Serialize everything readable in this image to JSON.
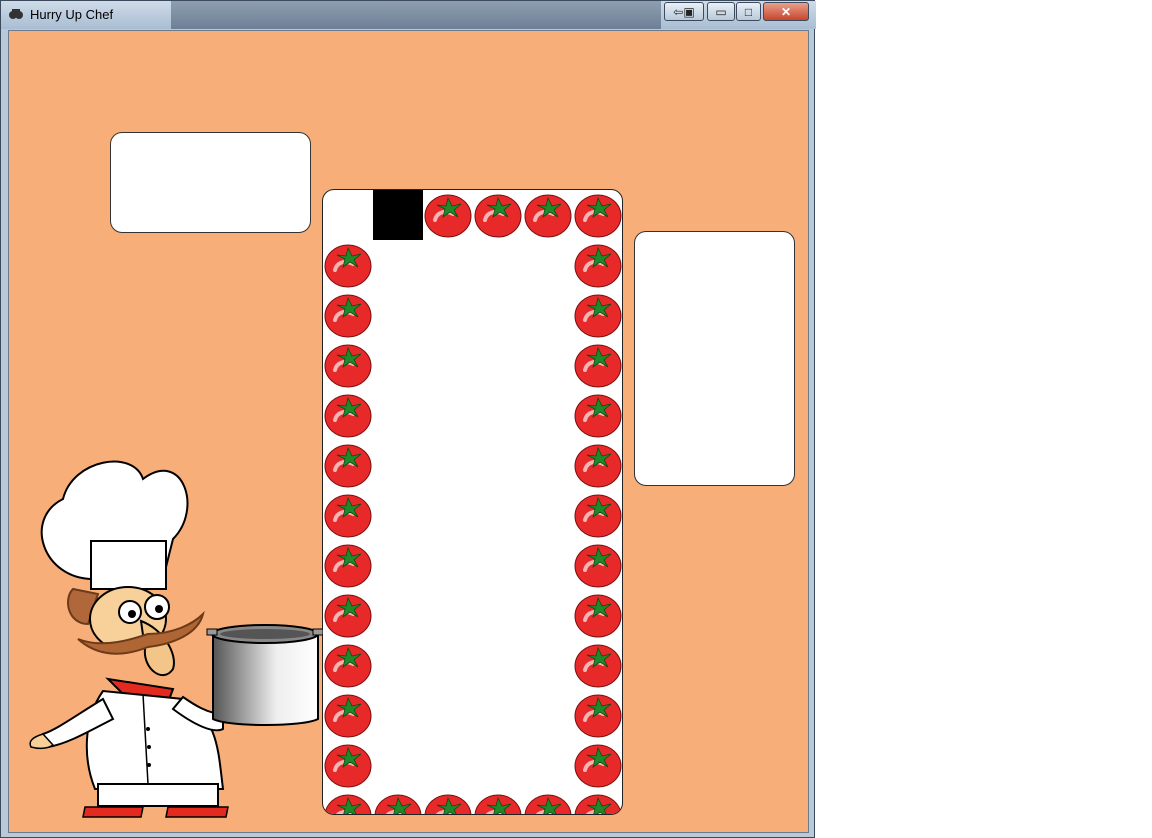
{
  "window": {
    "title": "Hurry Up Chef",
    "controls": {
      "minimize": "▭",
      "maximize": "□",
      "close": "✕"
    }
  },
  "colors": {
    "background": "#f8ae78",
    "tomato": "#e8292a",
    "leaf": "#1f8a2a",
    "player": "#000000"
  },
  "board": {
    "columns": 6,
    "rows": 13,
    "player_cell": {
      "col": 1,
      "row": 0
    },
    "border_item": "tomato-icon"
  },
  "panels": {
    "order_panel_text": "",
    "score_panel_text": ""
  },
  "character": {
    "icon": "chef-with-pot-icon"
  }
}
